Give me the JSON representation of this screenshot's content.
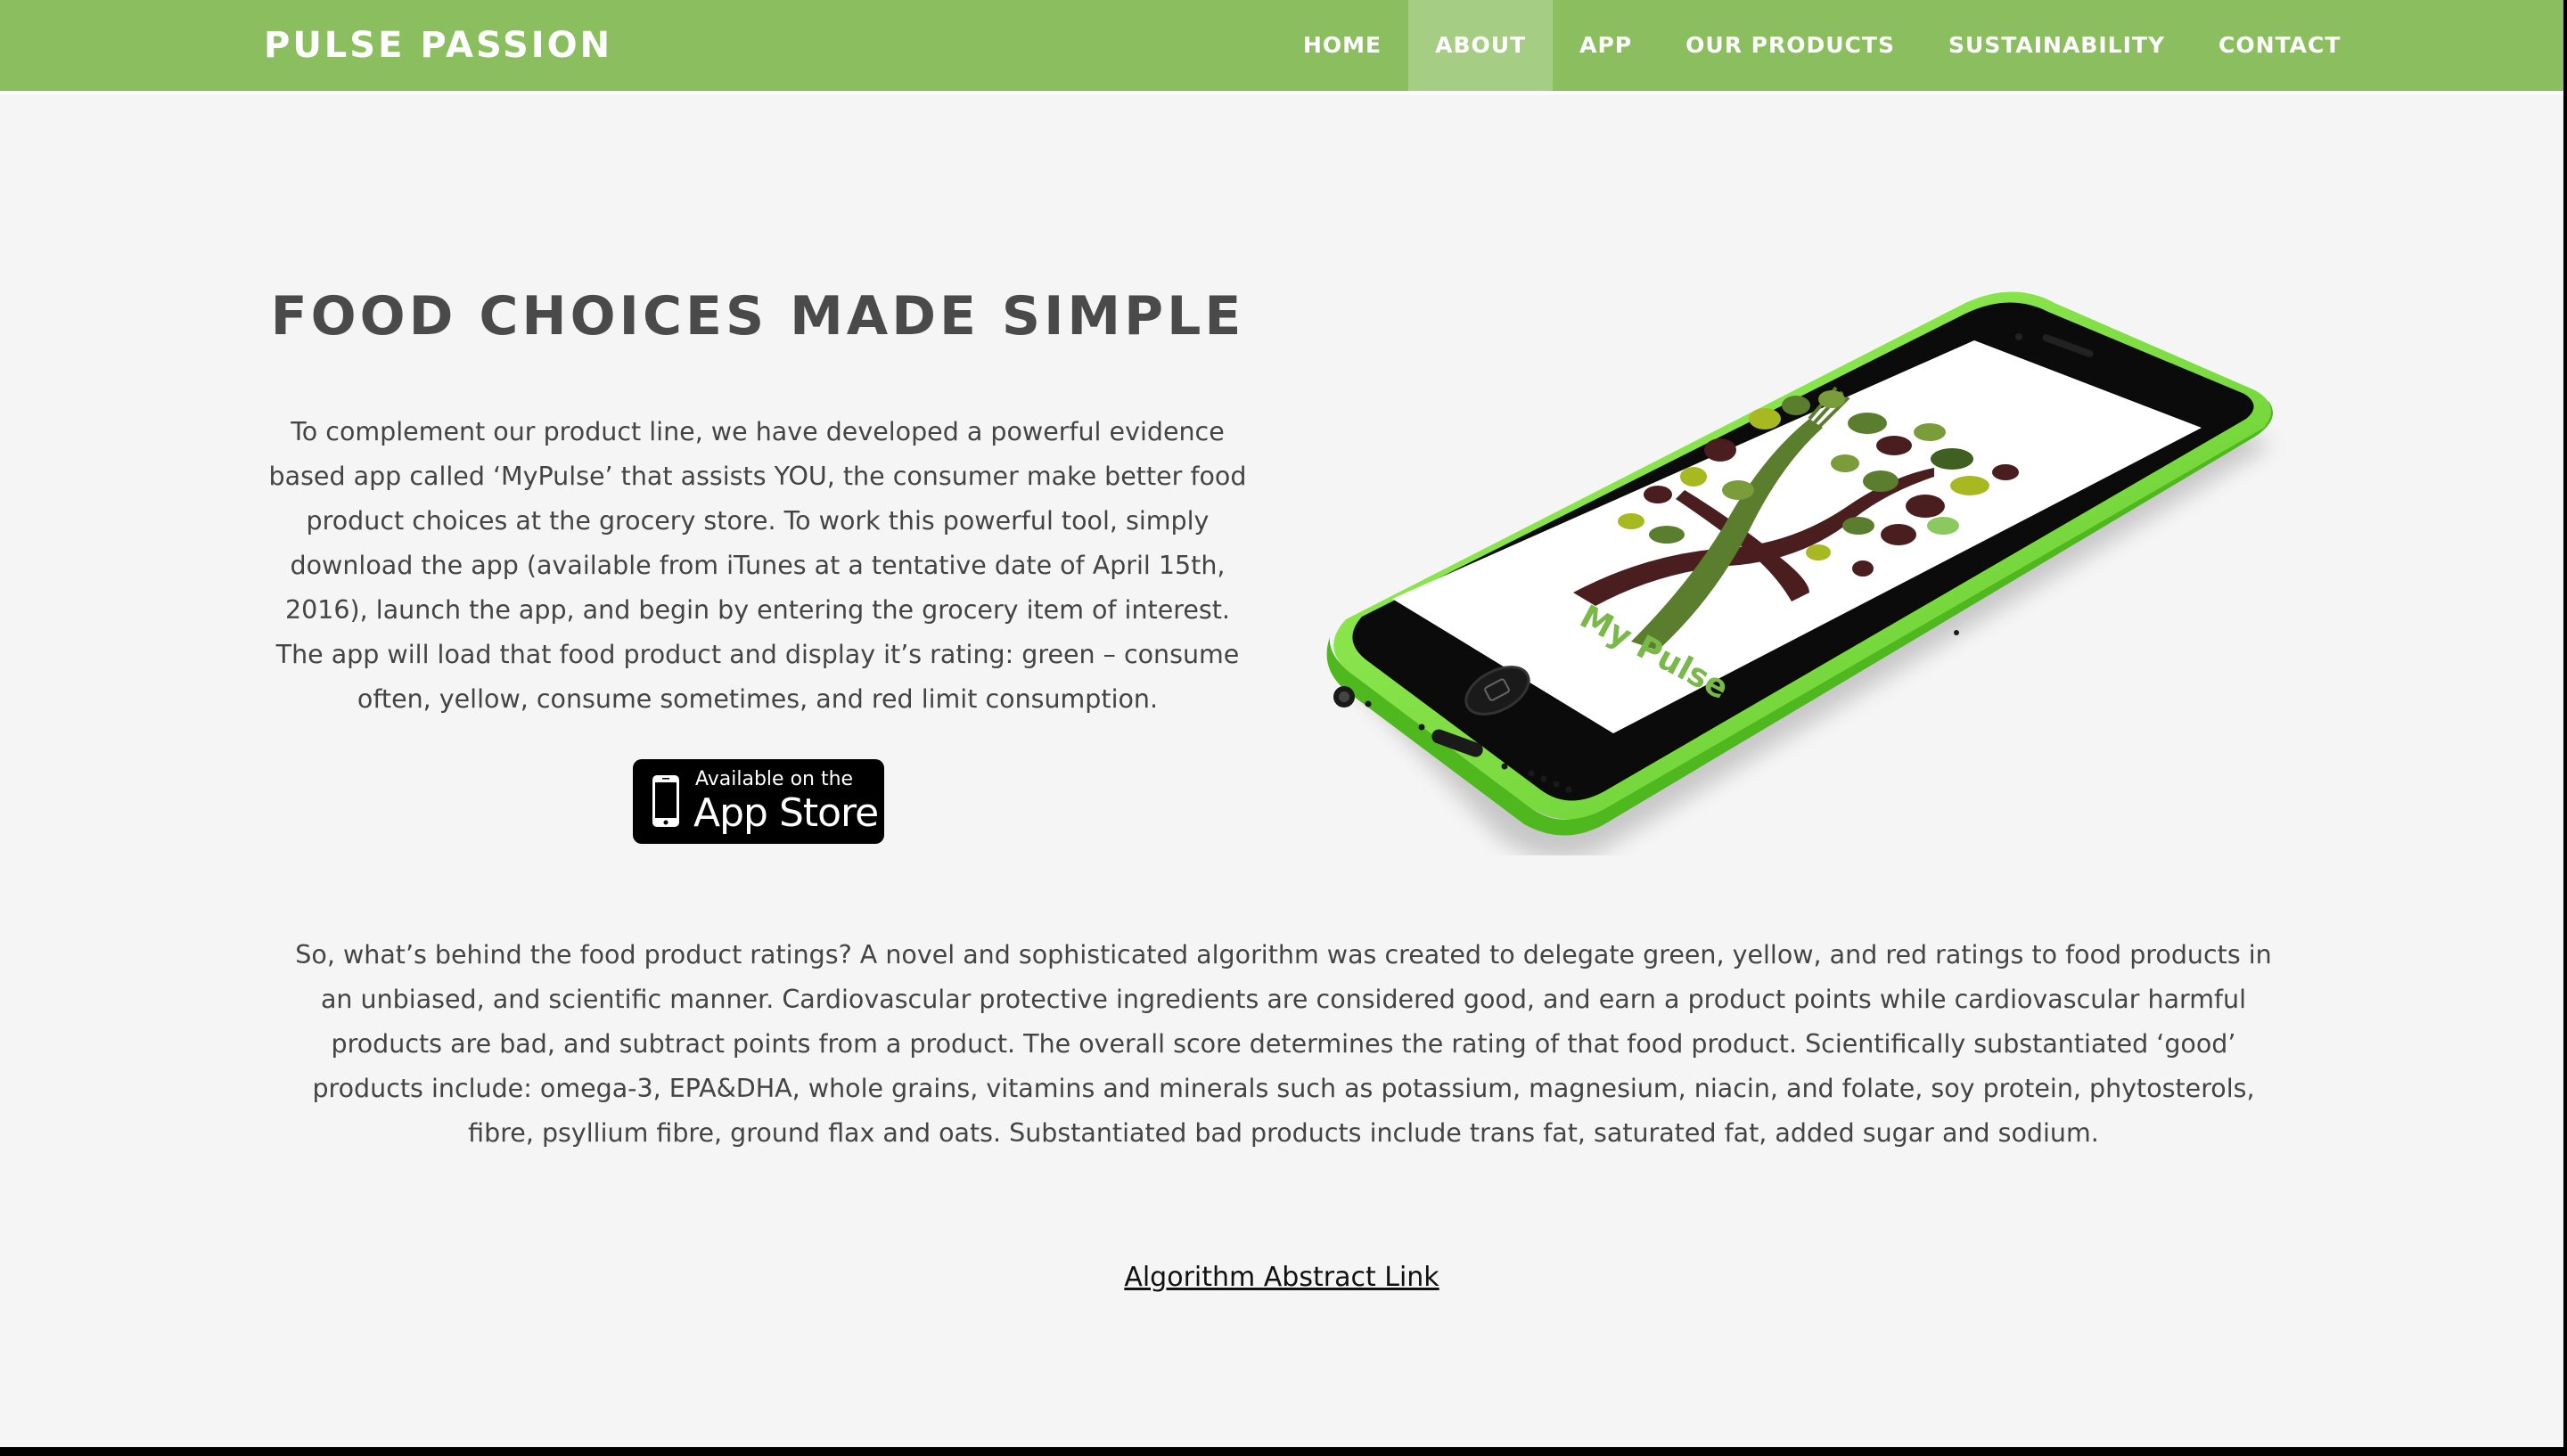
{
  "navbar": {
    "brand": "PULSE PASSION",
    "items": [
      {
        "label": "HOME",
        "active": false
      },
      {
        "label": "ABOUT",
        "active": true
      },
      {
        "label": "APP",
        "active": false
      },
      {
        "label": "OUR PRODUCTS",
        "active": false
      },
      {
        "label": "SUSTAINABILITY",
        "active": false
      },
      {
        "label": "CONTACT",
        "active": false
      }
    ]
  },
  "hero": {
    "title": "FOOD CHOICES MADE SIMPLE",
    "paragraph": "To complement our product line, we have developed a powerful evidence based app called ‘MyPulse’ that assists YOU, the consumer make better food product choices at the grocery store. To work this powerful tool, simply download the app (available from iTunes at a tentative date of April 15th, 2016), launch the app, and begin by entering the grocery item of interest. The app will load that food product and display it’s rating: green – consume often, yellow, consume sometimes, and red limit consumption.",
    "badge": {
      "small_text": "Available on the",
      "big_text": "App Store"
    },
    "phone_logo_text": "My Pulse"
  },
  "algorithm": {
    "paragraph": "So, what’s behind the food product ratings? A novel and sophisticated algorithm was created to delegate green, yellow, and red ratings to food products in an unbiased, and scientific manner. Cardiovascular protective ingredients are considered good, and earn a product points while cardiovascular harmful products are bad, and subtract points from a product. The overall score determines the rating of that food product. Scientifically substantiated ‘good’ products include: omega-3, EPA&DHA, whole grains, vitamins and minerals such as potassium, magnesium, niacin, and folate, soy protein, phytosterols, fibre, psyllium fibre, ground flax and oats. Substantiated bad products include trans fat, saturated fat, added sugar and sodium.",
    "link_label": "Algorithm Abstract Link"
  },
  "colors": {
    "navbar": "#8bbe5f",
    "nav_active": "#a6cd84",
    "page_background": "#f5f5f5",
    "phone_body": "#7ee03a",
    "text": "#444444"
  }
}
